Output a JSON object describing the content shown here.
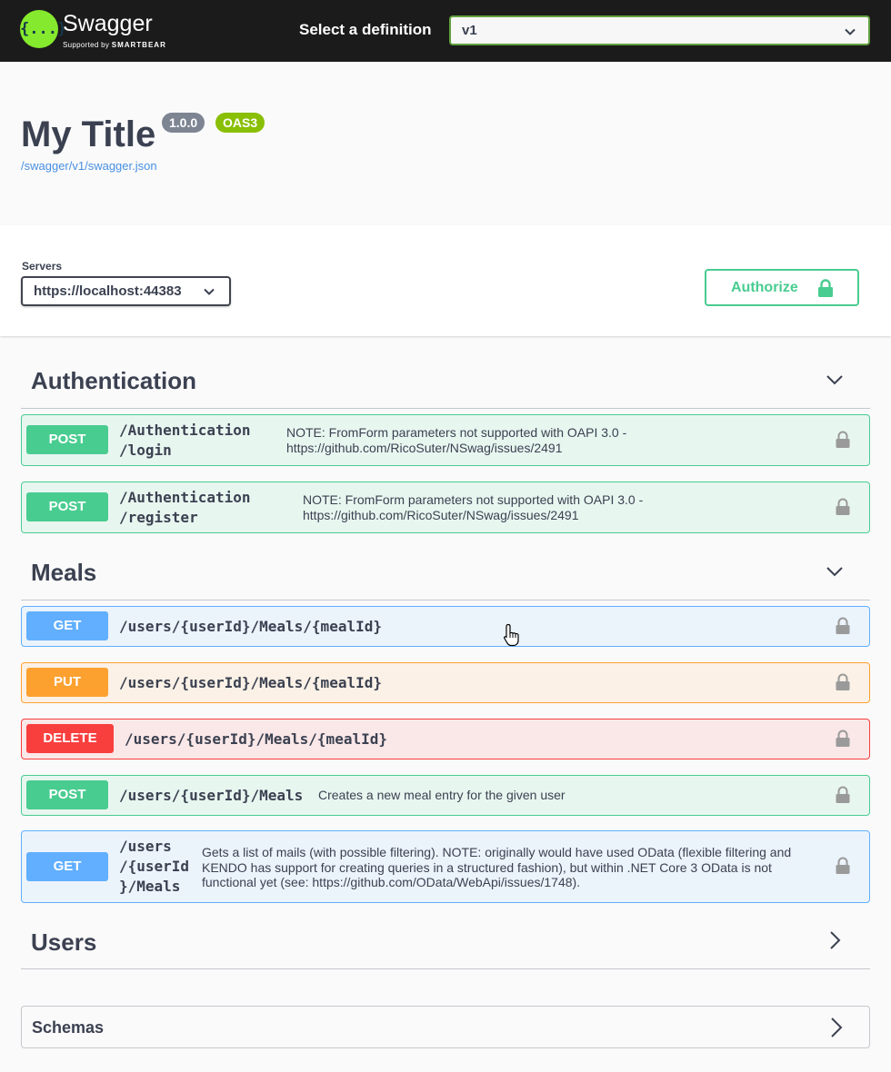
{
  "topbar": {
    "logo_glyph": "{...}",
    "brand": "Swagger",
    "brand_sub_prefix": "Supported by",
    "brand_sub_company": "SMARTBEAR",
    "definition_label": "Select a definition",
    "definition_value": "v1"
  },
  "info": {
    "title": "My Title",
    "version": "1.0.0",
    "spec": "OAS3",
    "spec_url": "/swagger/v1/swagger.json"
  },
  "servers": {
    "label": "Servers",
    "selected": "https://localhost:44383",
    "authorize_label": "Authorize"
  },
  "sections": [
    {
      "name": "Authentication",
      "expanded": true,
      "operations": [
        {
          "method": "POST",
          "path_lines": [
            "/Authentication",
            "/login"
          ],
          "description": "NOTE: FromForm parameters not supported with OAPI 3.0 - https://github.com/RicoSuter/NSwag/issues/2491"
        },
        {
          "method": "POST",
          "path_lines": [
            "/Authentication",
            "/register"
          ],
          "description": "NOTE: FromForm parameters not supported with OAPI 3.0 - https://github.com/RicoSuter/NSwag/issues/2491"
        }
      ]
    },
    {
      "name": "Meals",
      "expanded": true,
      "operations": [
        {
          "method": "GET",
          "path": "/users/{userId}/Meals/{mealId}",
          "description": ""
        },
        {
          "method": "PUT",
          "path": "/users/{userId}/Meals/{mealId}",
          "description": ""
        },
        {
          "method": "DELETE",
          "path": "/users/{userId}/Meals/{mealId}",
          "description": ""
        },
        {
          "method": "POST",
          "path": "/users/{userId}/Meals",
          "description": "Creates a new meal entry for the given user"
        },
        {
          "method": "GET",
          "path_lines": [
            "/users",
            "/{userId",
            "}/Meals"
          ],
          "description": "Gets a list of mails (with possible filtering). NOTE: originally would have used OData (flexible filtering and KENDO has support for creating queries in a structured fashion), but within .NET Core 3 OData is not functional yet (see: https://github.com/OData/WebApi/issues/1748)."
        }
      ]
    },
    {
      "name": "Users",
      "expanded": false
    }
  ],
  "schemas": {
    "label": "Schemas",
    "expanded": false
  },
  "colors": {
    "post": "#49cc90",
    "get": "#61affe",
    "put": "#fca130",
    "delete": "#f93e3e",
    "accent_green": "#89bf04",
    "topbar": "#1b1b1b"
  },
  "icons": {
    "logo": "swagger-logo-icon",
    "expand": "chevron-down-icon",
    "collapse": "chevron-right-icon",
    "lock": "lock-icon",
    "cursor": "hand-pointer-icon"
  }
}
